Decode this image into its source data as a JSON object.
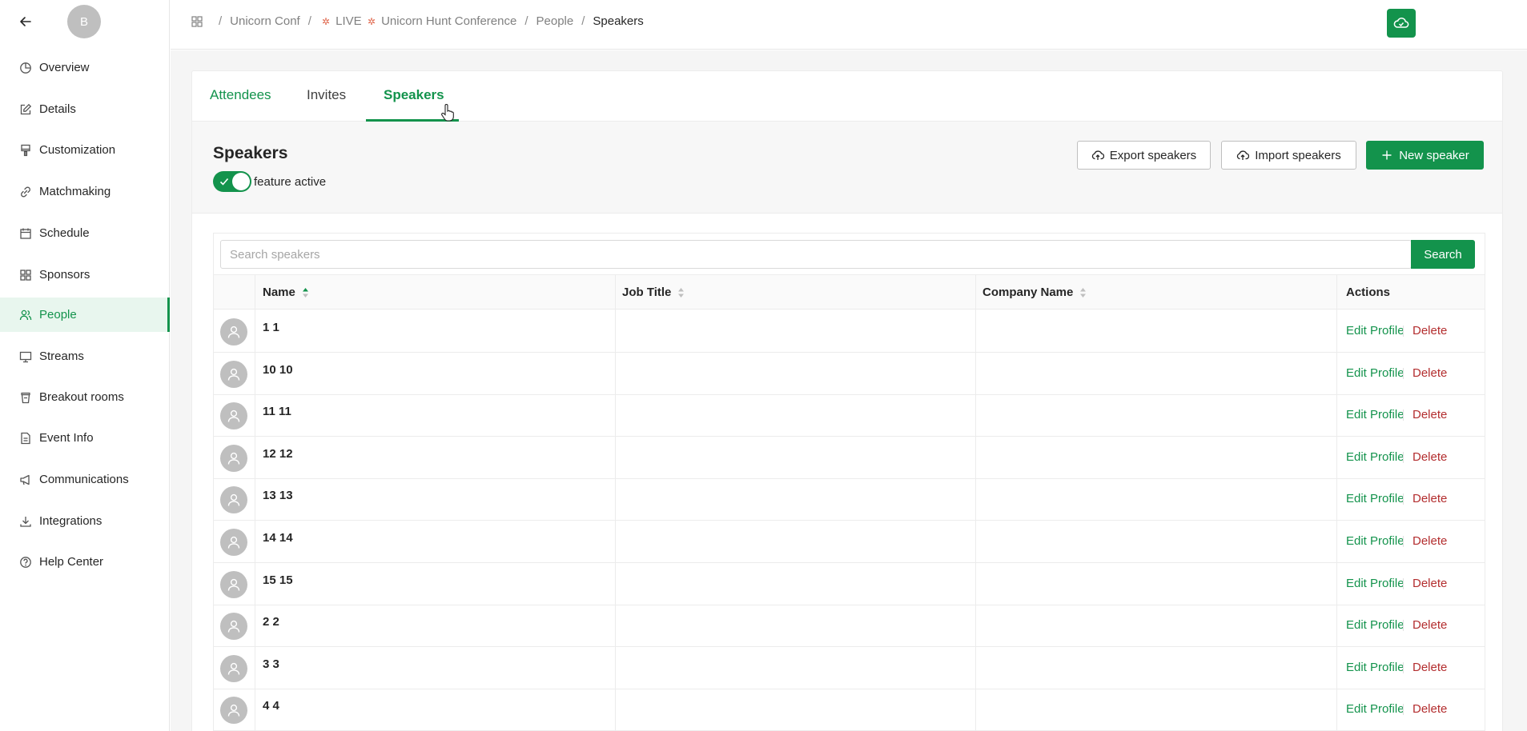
{
  "sidebar": {
    "avatar_initial": "B",
    "items": [
      {
        "label": "Overview",
        "icon": "chart-pie-icon"
      },
      {
        "label": "Details",
        "icon": "edit-icon"
      },
      {
        "label": "Customization",
        "icon": "paint-brush-icon"
      },
      {
        "label": "Matchmaking",
        "icon": "link-icon"
      },
      {
        "label": "Schedule",
        "icon": "calendar-icon"
      },
      {
        "label": "Sponsors",
        "icon": "grid-icon"
      },
      {
        "label": "People",
        "icon": "people-icon"
      },
      {
        "label": "Streams",
        "icon": "monitor-icon"
      },
      {
        "label": "Breakout rooms",
        "icon": "cup-icon"
      },
      {
        "label": "Event Info",
        "icon": "document-icon"
      },
      {
        "label": "Communications",
        "icon": "megaphone-icon"
      },
      {
        "label": "Integrations",
        "icon": "download-icon"
      },
      {
        "label": "Help Center",
        "icon": "help-circle-icon"
      }
    ],
    "active": "People"
  },
  "breadcrumb": {
    "items": [
      "Unicorn Conf",
      "LIVE",
      "Unicorn Hunt Conference",
      "People",
      "Speakers"
    ]
  },
  "tabs": [
    "Attendees",
    "Invites",
    "Speakers"
  ],
  "active_tab": "Speakers",
  "header": {
    "title": "Speakers",
    "export_label": "Export speakers",
    "import_label": "Import speakers",
    "new_label": "New speaker",
    "toggle_label": "feature active",
    "toggle_on": true
  },
  "search": {
    "placeholder": "Search speakers",
    "value": "",
    "button_label": "Search"
  },
  "table": {
    "columns": [
      "Name",
      "Job Title",
      "Company Name",
      "Actions"
    ],
    "sort_column": "Name",
    "edit_label": "Edit Profile",
    "delete_label": "Delete",
    "rows": [
      {
        "name": "1 1",
        "job_title": "",
        "company": ""
      },
      {
        "name": "10 10",
        "job_title": "",
        "company": ""
      },
      {
        "name": "11 11",
        "job_title": "",
        "company": ""
      },
      {
        "name": "12 12",
        "job_title": "",
        "company": ""
      },
      {
        "name": "13 13",
        "job_title": "",
        "company": ""
      },
      {
        "name": "14 14",
        "job_title": "",
        "company": ""
      },
      {
        "name": "15 15",
        "job_title": "",
        "company": ""
      },
      {
        "name": "2 2",
        "job_title": "",
        "company": ""
      },
      {
        "name": "3 3",
        "job_title": "",
        "company": ""
      },
      {
        "name": "4 4",
        "job_title": "",
        "company": ""
      }
    ]
  },
  "colors": {
    "accent": "#13934c",
    "danger": "#b32d2e",
    "active_bg": "#e8f6ee"
  }
}
